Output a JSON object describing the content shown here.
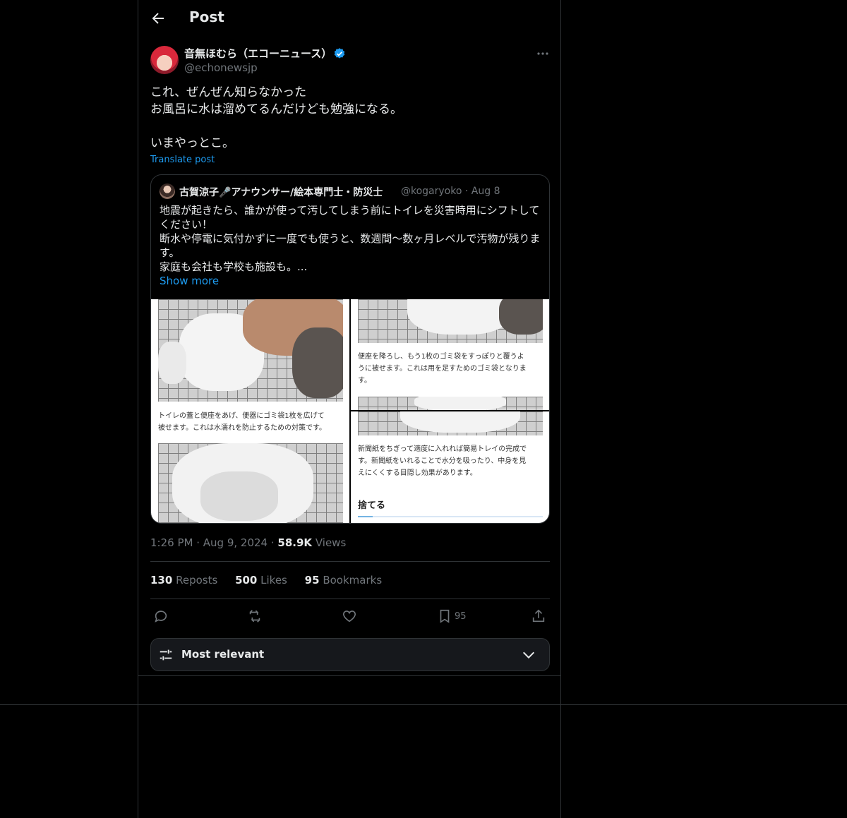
{
  "header": {
    "title": "Post"
  },
  "post": {
    "author_name": "音無ほむら（エコーニュース）",
    "author_handle": "@echonewsjp",
    "text": "これ、ぜんぜん知らなかった\nお風呂に水は溜めてるんだけども勉強になる。\n\nいまやっとこ。",
    "translate_label": "Translate post",
    "time": "1:26 PM",
    "date": "Aug 9, 2024",
    "views_count": "58.9K",
    "views_label": "Views"
  },
  "quote": {
    "author_name": "古賀涼子🎤アナウンサー/絵本専門士・防災士",
    "author_handle": "@kogaryoko",
    "date": "Aug 8",
    "text": "地震が起きたら、誰かが使って汚してしまう前にトイレを災害時用にシフトしてください！\n断水や停電に気付かずに一度でも使うと、数週間〜数ヶ月レベルで汚物が残ります。\n家庭も会社も学校も施設も。...",
    "show_more": "Show more",
    "captions": [
      "トイレの蓋と便座をあげ、便器にゴミ袋1枚を広げて\n被せます。これは水濡れを防止するための対策です。",
      "便座を降ろし、もう1枚のゴミ袋をすっぽりと覆うよ\nうに被せます。これは用を足すためのゴミ袋となりま\nす。",
      "新聞紙をちぎって適度に入れれば簡易トレイの完成で\nす。新聞紙をいれることで水分を吸ったり、中身を見\nえにくくする目隠し効果があります。"
    ],
    "section_title": "捨てる",
    "progress": 0.08
  },
  "stats": {
    "reposts_count": "130",
    "reposts_label": "Reposts",
    "likes_count": "500",
    "likes_label": "Likes",
    "bookmarks_count": "95",
    "bookmarks_label": "Bookmarks"
  },
  "actions": {
    "bookmark_count": "95"
  },
  "sort": {
    "label": "Most relevant"
  },
  "colors": {
    "background": "#000000",
    "accent": "#1d9bf0",
    "muted": "#71767b",
    "border": "#2f3336"
  }
}
